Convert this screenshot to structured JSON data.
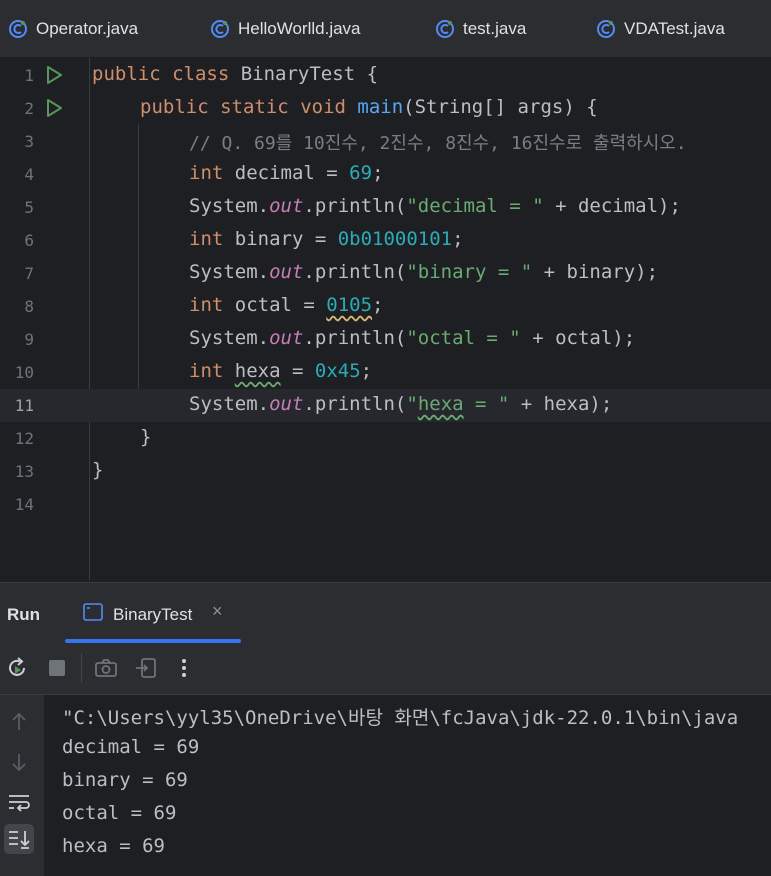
{
  "tabs": [
    {
      "label": "Operator.java"
    },
    {
      "label": "HelloWorlld.java"
    },
    {
      "label": "test.java"
    },
    {
      "label": "VDATest.java"
    }
  ],
  "editor": {
    "line_numbers": [
      "1",
      "2",
      "3",
      "4",
      "5",
      "6",
      "7",
      "8",
      "9",
      "10",
      "11",
      "12",
      "13",
      "14"
    ],
    "current_line": "11",
    "code": {
      "l1": {
        "kw1": "public",
        "kw2": "class",
        "name": " BinaryTest {"
      },
      "l2": {
        "kw1": "public",
        "kw2": "static",
        "kw3": "void",
        "fn": "main",
        "rest": "(String[] args) {"
      },
      "l3": {
        "comment": "// Q. 69를 10진수, 2진수, 8진수, 16진수로 출력하시오."
      },
      "l4": {
        "type": "int",
        "var": " decimal = ",
        "num": "69",
        "end": ";"
      },
      "l5": {
        "sys": "System.",
        "out": "out",
        "call": ".println(",
        "str": "\"decimal = \"",
        "rest": " + decimal);"
      },
      "l6": {
        "type": "int",
        "var": " binary = ",
        "num": "0b01000101",
        "end": ";"
      },
      "l7": {
        "sys": "System.",
        "out": "out",
        "call": ".println(",
        "str": "\"binary = \"",
        "rest": " + binary);"
      },
      "l8": {
        "type": "int",
        "var": " octal = ",
        "num": "0105",
        "end": ";"
      },
      "l9": {
        "sys": "System.",
        "out": "out",
        "call": ".println(",
        "str": "\"octal = \"",
        "rest": " + octal);"
      },
      "l10": {
        "type": "int",
        "sp": " ",
        "var": "hexa",
        "eq": " = ",
        "num": "0x45",
        "end": ";"
      },
      "l11": {
        "sys": "System.",
        "out": "out",
        "call": ".println(",
        "q": "\"",
        "strw": "hexa",
        "str": " = \"",
        "rest": " + hexa);"
      },
      "l12": {
        "brace": "}"
      },
      "l13": {
        "brace": "}"
      }
    }
  },
  "run": {
    "title": "Run",
    "tab_label": "BinaryTest",
    "close": "×",
    "console": [
      "\"C:\\Users\\yyl35\\OneDrive\\바탕 화면\\fcJava\\jdk-22.0.1\\bin\\java",
      "decimal = 69",
      "binary = 69",
      "octal = 69",
      "hexa = 69"
    ]
  },
  "colors": {
    "accent": "#3574f0",
    "run_green": "#57965c",
    "keyword": "#cf8e6d",
    "number": "#2aacb8",
    "string": "#6aab73"
  }
}
